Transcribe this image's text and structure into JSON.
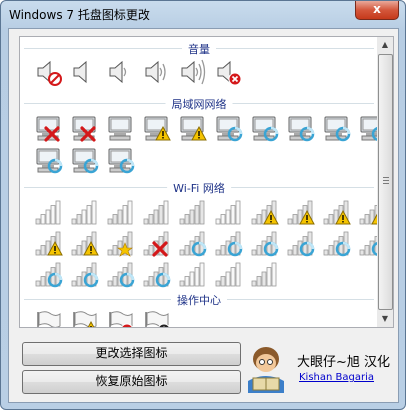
{
  "window": {
    "title": "Windows 7 托盘图标更改",
    "close_label": "x"
  },
  "sections": [
    {
      "label": "音量",
      "icons": [
        "speaker-muted-icon",
        "speaker-icon",
        "speaker-low-icon",
        "speaker-medium-icon",
        "speaker-high-icon",
        "speaker-error-icon"
      ]
    },
    {
      "label": "局域网网络",
      "icons": [
        "network-error-icon",
        "network-error-icon",
        "network-icon",
        "network-warning-icon",
        "network-warning-icon",
        "network-busy-icon",
        "network-busy-icon",
        "network-busy-icon",
        "network-busy-icon",
        "network-busy-icon",
        "network-busy-icon",
        "network-busy-icon",
        "network-busy-icon"
      ]
    },
    {
      "label": "Wi-Fi 网络",
      "icons": [
        "wifi-1-icon",
        "wifi-2-icon",
        "wifi-3-icon",
        "wifi-4-icon",
        "wifi-5-icon",
        "wifi-empty-icon",
        "wifi-warning-icon",
        "wifi-warning-icon",
        "wifi-warning-icon",
        "wifi-warning-icon",
        "wifi-warning-icon",
        "wifi-warning-icon",
        "wifi-star-icon",
        "wifi-error-icon",
        "wifi-busy-icon",
        "wifi-busy-icon",
        "wifi-busy-icon",
        "wifi-busy-icon",
        "wifi-busy-icon",
        "wifi-busy-icon",
        "wifi-busy-icon",
        "wifi-busy-icon",
        "wifi-busy-icon",
        "wifi-busy-icon",
        "wifi-1-icon",
        "wifi-2-icon",
        "wifi-3-icon"
      ]
    },
    {
      "label": "操作中心",
      "icons": [
        "flag-icon",
        "flag-warning-icon",
        "flag-error-icon",
        "flag-clock-icon"
      ]
    }
  ],
  "buttons": {
    "change": "更改选择图标",
    "restore": "恢复原始图标"
  },
  "credits": {
    "name": "大眼仔~旭 汉化",
    "link": "Kishan Bagaria"
  },
  "colors": {
    "accent": "#1e3287",
    "error": "#d4181a",
    "warning": "#f5c400",
    "busy": "#3aa4d4"
  }
}
